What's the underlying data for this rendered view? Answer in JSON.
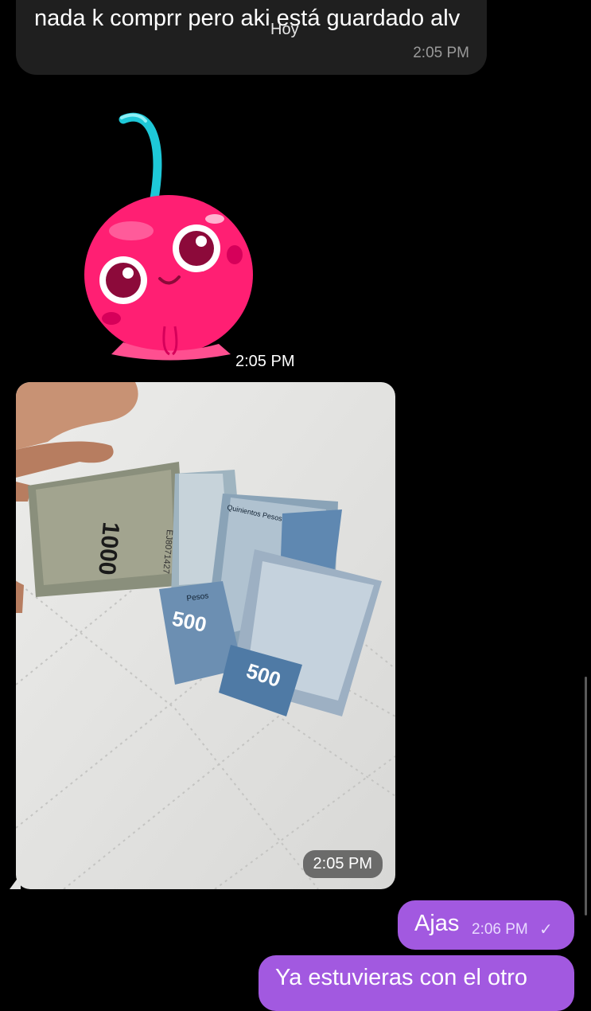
{
  "chat": {
    "date_separator": "Hoy",
    "messages": [
      {
        "direction": "in",
        "type": "text",
        "text": "nada k comprr pero aki está guardado alv",
        "time": "2:05 PM"
      },
      {
        "direction": "in",
        "type": "sticker",
        "sticker_icon": "cherry-sticker-icon",
        "time": "2:05 PM"
      },
      {
        "direction": "in",
        "type": "photo",
        "time": "2:05 PM",
        "banknote_labels": {
          "big": "1000",
          "mid": "500",
          "small": "500",
          "serial": "EJ8071427",
          "word": "Pesos",
          "word2": "Quinientos Pesos"
        }
      },
      {
        "direction": "out",
        "type": "text",
        "text": "Ajas",
        "time": "2:06 PM",
        "status_icon": "check-icon"
      },
      {
        "direction": "out",
        "type": "text",
        "text": "Ya estuvieras con el otro"
      }
    ]
  },
  "colors": {
    "background": "#000000",
    "incoming_bubble": "#1f1f1f",
    "outgoing_bubble": "#a259e0"
  }
}
